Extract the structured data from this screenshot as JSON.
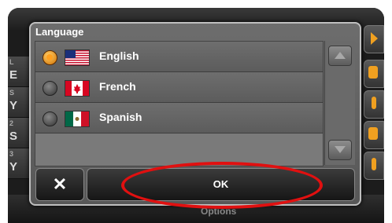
{
  "dialog": {
    "title": "Language"
  },
  "languages": [
    {
      "label": "English",
      "selected": true,
      "flag": "us-flag"
    },
    {
      "label": "French",
      "selected": false,
      "flag": "canada-flag"
    },
    {
      "label": "Spanish",
      "selected": false,
      "flag": "mexico-flag"
    }
  ],
  "buttons": {
    "cancel": "✕",
    "ok": "OK"
  },
  "background": {
    "left_rows": [
      {
        "small": "L",
        "big": "E"
      },
      {
        "small": "S",
        "big": "Y"
      },
      {
        "small": "2",
        "big": "S"
      },
      {
        "small": "3",
        "big": "Y"
      }
    ],
    "bottom_label": "Options"
  },
  "colors": {
    "accent_orange": "#f0a020",
    "annotation_red": "#e01010",
    "dialog_gray": "#6d6d6d"
  }
}
